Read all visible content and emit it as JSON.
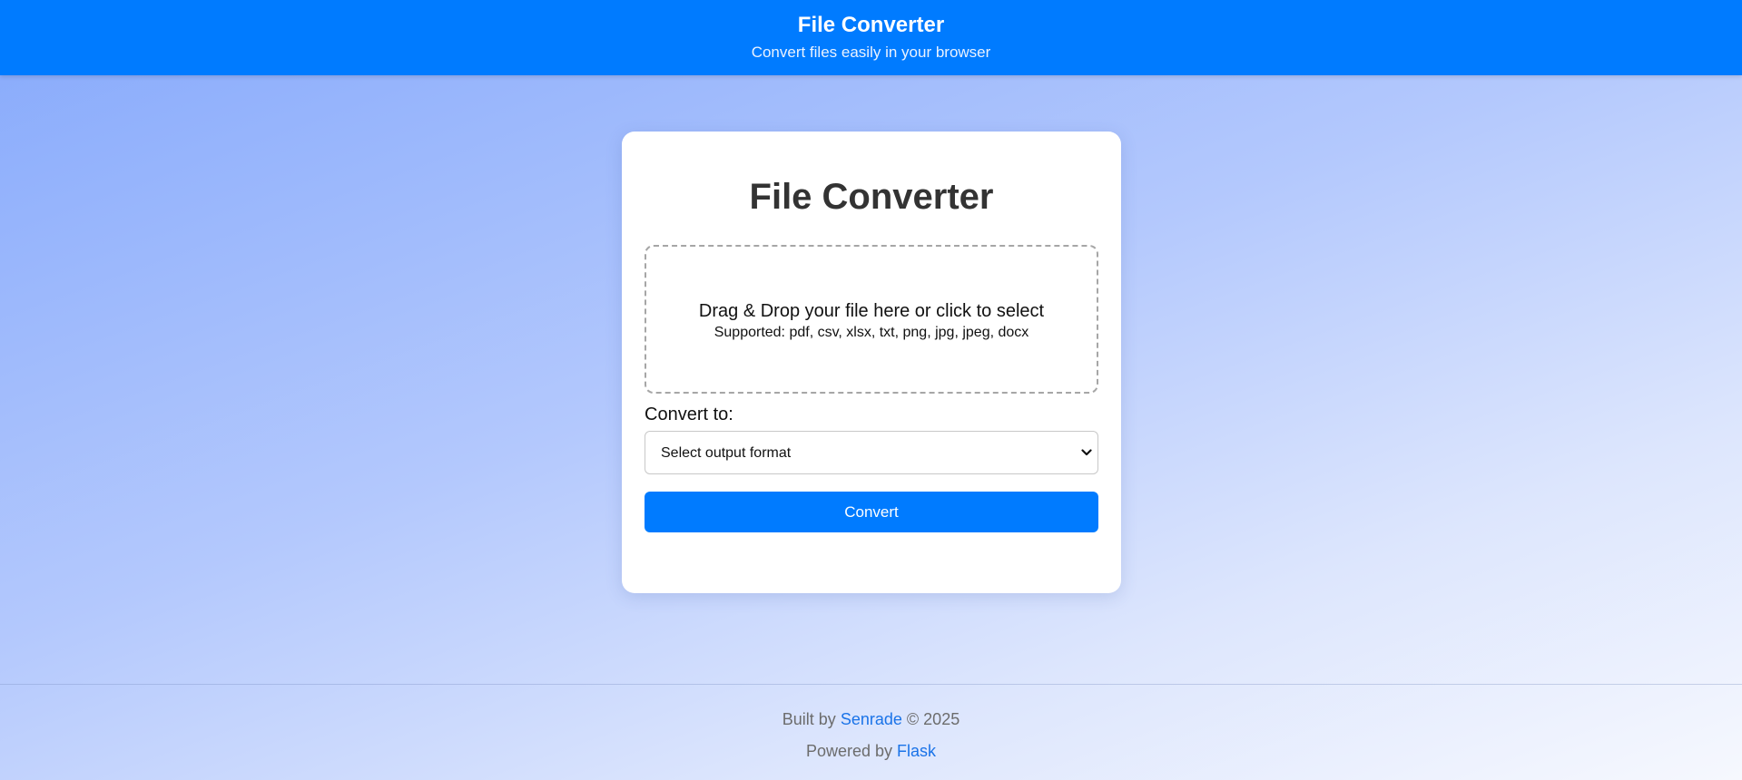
{
  "header": {
    "title": "File Converter",
    "subtitle": "Convert files easily in your browser"
  },
  "card": {
    "title": "File Converter",
    "dropzone": {
      "main_text": "Drag & Drop your file here or click to select",
      "supported_text": "Supported: pdf, csv, xlsx, txt, png, jpg, jpeg, docx"
    },
    "convert_to_label": "Convert to:",
    "format_select": {
      "selected": "Select output format"
    },
    "convert_button_label": "Convert"
  },
  "footer": {
    "built_by_prefix": "Built by",
    "built_by_link": "Senrade",
    "built_by_suffix": "© 2025",
    "powered_by_prefix": "Powered by",
    "powered_by_link": "Flask"
  },
  "colors": {
    "primary": "#007bff",
    "link": "#1a73e8",
    "footer_text": "#6c6c6c",
    "card_title": "#333333"
  },
  "icons": {
    "select_chevron": "chevron-down-icon"
  }
}
